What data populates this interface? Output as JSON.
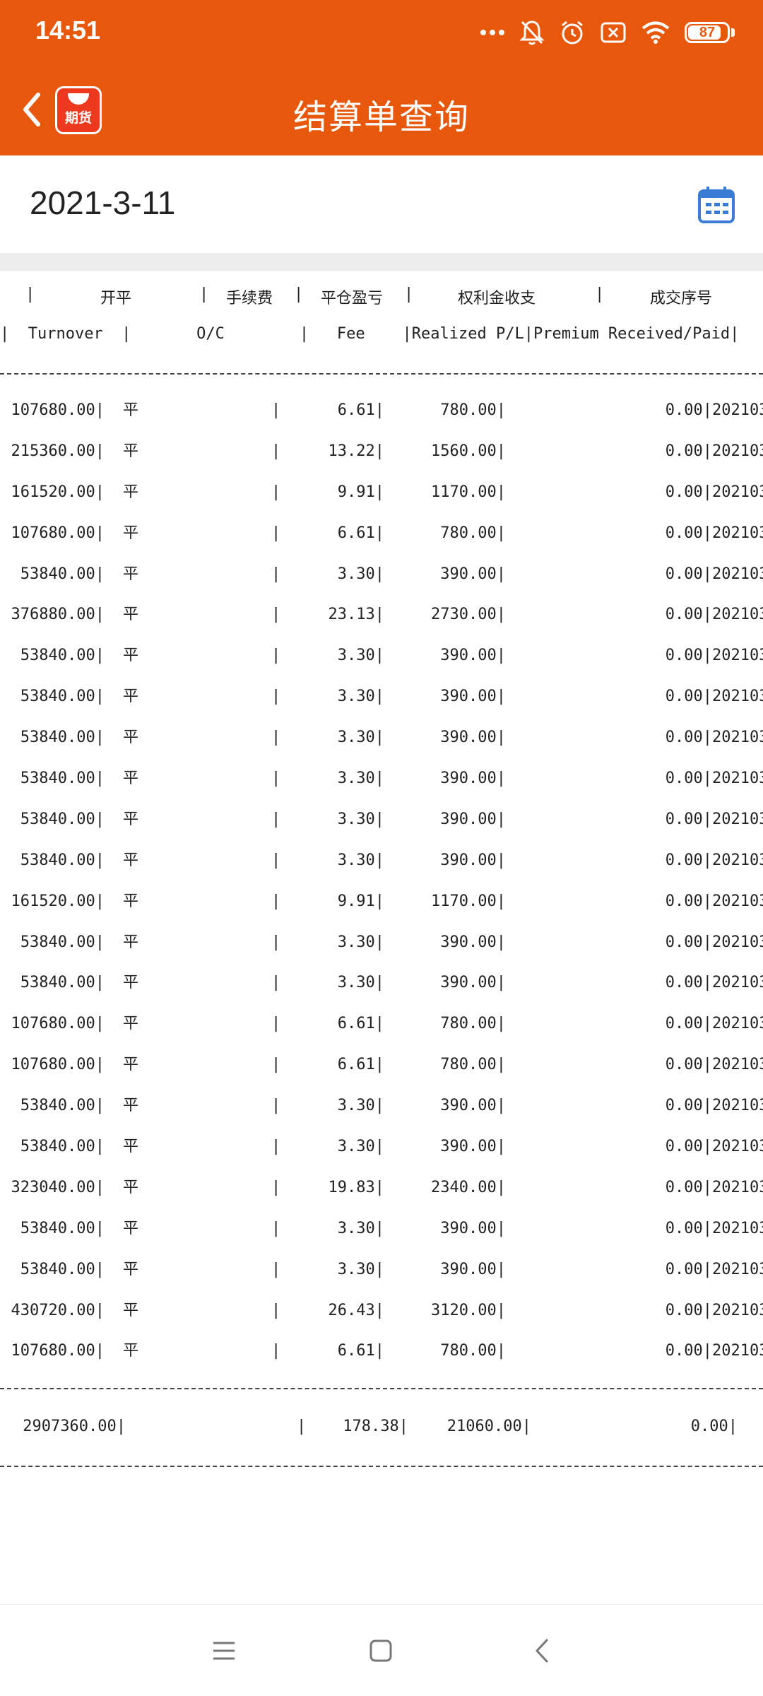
{
  "status_bar": {
    "time": "14:51",
    "battery": "87",
    "battery_level": 0.87,
    "icons": [
      "more-dots-icon",
      "bell-muted-icon",
      "alarm-icon",
      "sim-off-icon",
      "wifi-icon",
      "battery-icon"
    ]
  },
  "header": {
    "title": "结算单查询",
    "logo_text": "期货",
    "back_icon": "chevron-left-icon",
    "bg_color": "#E8580C"
  },
  "date_bar": {
    "date": "2021-3-11",
    "calendar_icon": "calendar-icon",
    "icon_color": "#3A7BD5"
  },
  "report": {
    "header_cn": {
      "oc": "开平",
      "fee": "手续费",
      "realized_pl": "平仓盈亏",
      "premium": "权利金收支",
      "trade_seq": "成交序号"
    },
    "header_en": "|  Turnover  |       O/C        |   Fee    |Realized P/L|Premium Received/Paid|",
    "rows": [
      {
        "turnover": "107680.00|",
        "oc": "平",
        "bar": "|",
        "fee": "6.61|",
        "pl": "780.00|",
        "premium": "0.00|",
        "seq": "202103"
      },
      {
        "turnover": "215360.00|",
        "oc": "平",
        "bar": "|",
        "fee": "13.22|",
        "pl": "1560.00|",
        "premium": "0.00|",
        "seq": "202103"
      },
      {
        "turnover": "161520.00|",
        "oc": "平",
        "bar": "|",
        "fee": "9.91|",
        "pl": "1170.00|",
        "premium": "0.00|",
        "seq": "202103"
      },
      {
        "turnover": "107680.00|",
        "oc": "平",
        "bar": "|",
        "fee": "6.61|",
        "pl": "780.00|",
        "premium": "0.00|",
        "seq": "202103"
      },
      {
        "turnover": "53840.00|",
        "oc": "平",
        "bar": "|",
        "fee": "3.30|",
        "pl": "390.00|",
        "premium": "0.00|",
        "seq": "202103"
      },
      {
        "turnover": "376880.00|",
        "oc": "平",
        "bar": "|",
        "fee": "23.13|",
        "pl": "2730.00|",
        "premium": "0.00|",
        "seq": "202103"
      },
      {
        "turnover": "53840.00|",
        "oc": "平",
        "bar": "|",
        "fee": "3.30|",
        "pl": "390.00|",
        "premium": "0.00|",
        "seq": "202103"
      },
      {
        "turnover": "53840.00|",
        "oc": "平",
        "bar": "|",
        "fee": "3.30|",
        "pl": "390.00|",
        "premium": "0.00|",
        "seq": "202103"
      },
      {
        "turnover": "53840.00|",
        "oc": "平",
        "bar": "|",
        "fee": "3.30|",
        "pl": "390.00|",
        "premium": "0.00|",
        "seq": "202103"
      },
      {
        "turnover": "53840.00|",
        "oc": "平",
        "bar": "|",
        "fee": "3.30|",
        "pl": "390.00|",
        "premium": "0.00|",
        "seq": "202103"
      },
      {
        "turnover": "53840.00|",
        "oc": "平",
        "bar": "|",
        "fee": "3.30|",
        "pl": "390.00|",
        "premium": "0.00|",
        "seq": "202103"
      },
      {
        "turnover": "53840.00|",
        "oc": "平",
        "bar": "|",
        "fee": "3.30|",
        "pl": "390.00|",
        "premium": "0.00|",
        "seq": "202103"
      },
      {
        "turnover": "161520.00|",
        "oc": "平",
        "bar": "|",
        "fee": "9.91|",
        "pl": "1170.00|",
        "premium": "0.00|",
        "seq": "202103"
      },
      {
        "turnover": "53840.00|",
        "oc": "平",
        "bar": "|",
        "fee": "3.30|",
        "pl": "390.00|",
        "premium": "0.00|",
        "seq": "202103"
      },
      {
        "turnover": "53840.00|",
        "oc": "平",
        "bar": "|",
        "fee": "3.30|",
        "pl": "390.00|",
        "premium": "0.00|",
        "seq": "202103"
      },
      {
        "turnover": "107680.00|",
        "oc": "平",
        "bar": "|",
        "fee": "6.61|",
        "pl": "780.00|",
        "premium": "0.00|",
        "seq": "202103"
      },
      {
        "turnover": "107680.00|",
        "oc": "平",
        "bar": "|",
        "fee": "6.61|",
        "pl": "780.00|",
        "premium": "0.00|",
        "seq": "202103"
      },
      {
        "turnover": "53840.00|",
        "oc": "平",
        "bar": "|",
        "fee": "3.30|",
        "pl": "390.00|",
        "premium": "0.00|",
        "seq": "202103"
      },
      {
        "turnover": "53840.00|",
        "oc": "平",
        "bar": "|",
        "fee": "3.30|",
        "pl": "390.00|",
        "premium": "0.00|",
        "seq": "202103"
      },
      {
        "turnover": "323040.00|",
        "oc": "平",
        "bar": "|",
        "fee": "19.83|",
        "pl": "2340.00|",
        "premium": "0.00|",
        "seq": "202103"
      },
      {
        "turnover": "53840.00|",
        "oc": "平",
        "bar": "|",
        "fee": "3.30|",
        "pl": "390.00|",
        "premium": "0.00|",
        "seq": "202103"
      },
      {
        "turnover": "53840.00|",
        "oc": "平",
        "bar": "|",
        "fee": "3.30|",
        "pl": "390.00|",
        "premium": "0.00|",
        "seq": "202103"
      },
      {
        "turnover": "430720.00|",
        "oc": "平",
        "bar": "|",
        "fee": "26.43|",
        "pl": "3120.00|",
        "premium": "0.00|",
        "seq": "202103"
      },
      {
        "turnover": "107680.00|",
        "oc": "平",
        "bar": "|",
        "fee": "6.61|",
        "pl": "780.00|",
        "premium": "0.00|",
        "seq": "202103"
      }
    ],
    "total": {
      "turnover": "2907360.00|",
      "bar": "|",
      "fee": "178.38|",
      "pl": "21060.00|",
      "premium": "0.00|"
    }
  },
  "nav_bar": {
    "menu_icon": "menu-icon",
    "home_icon": "home-square-icon",
    "back_icon": "back-chevron-icon"
  }
}
